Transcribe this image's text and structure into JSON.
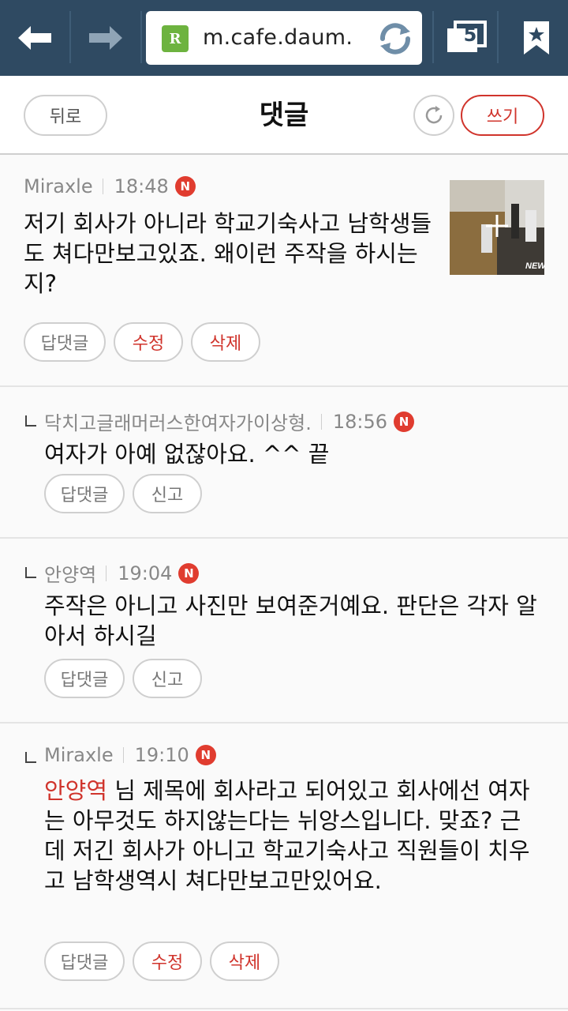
{
  "browser": {
    "url": "m.cafe.daum.",
    "tab_count": "5",
    "url_logo_letter": "R",
    "accent": "#2f4a62"
  },
  "header": {
    "back_label": "뒤로",
    "title": "댓글",
    "write_label": "쓰기"
  },
  "comments": [
    {
      "author": "Miraxle",
      "time": "18:48",
      "badge": "N",
      "text": "저기 회사가 아니라 학교기숙사고 남학생들도 쳐다만보고있죠. 왜이런 주작을 하시는지?",
      "actions": [
        "답댓글",
        "수정",
        "삭제"
      ]
    },
    {
      "author": "닥치고글래머러스한여자가이상형.",
      "time": "18:56",
      "badge": "N",
      "text": "여자가 아예 없잖아요. ^^ 끝",
      "actions": [
        "답댓글",
        "신고"
      ]
    },
    {
      "author": "안양역",
      "time": "19:04",
      "badge": "N",
      "text": "주작은 아니고 사진만 보여준거예요. 판단은 각자 알아서 하시길",
      "actions": [
        "답댓글",
        "신고"
      ]
    },
    {
      "author": "Miraxle",
      "time": "19:10",
      "badge": "N",
      "mention": "안양역",
      "text": " 님 제목에 회사라고 되어있고 회사에선 여자는 아무것도 하지않는다는 뉘앙스입니다. 맞죠? 근데 저긴 회사가 아니고 학교기숙사고 직원들이 치우고 남학생역시 쳐다만보고만있어요.",
      "actions": [
        "답댓글",
        "수정",
        "삭제"
      ]
    }
  ],
  "thumbnail": {
    "watermark": "NEW"
  }
}
